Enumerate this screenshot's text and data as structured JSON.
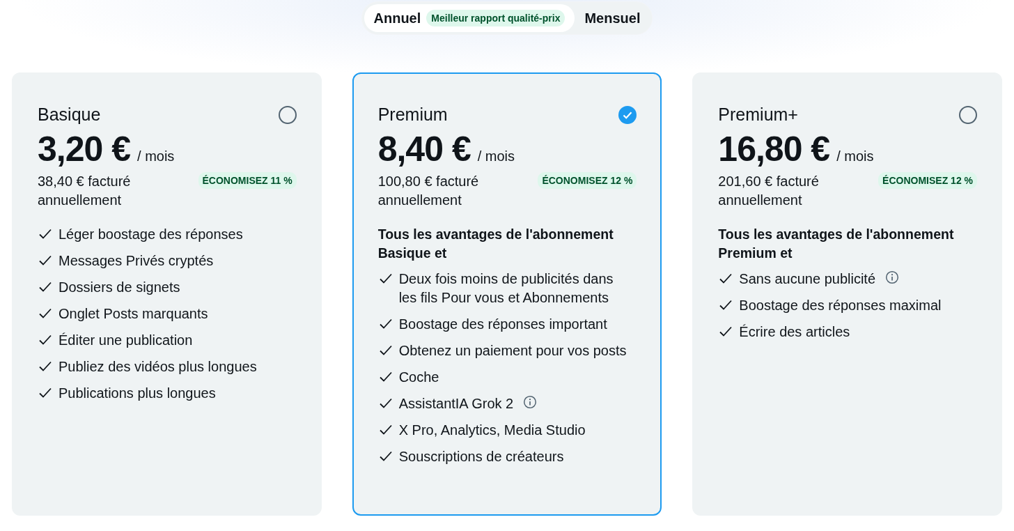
{
  "billing_toggle": [
    {
      "label": "Annuel",
      "selected": true,
      "badge": "Meilleur rapport qualité-prix"
    },
    {
      "label": "Mensuel",
      "selected": false
    }
  ],
  "plans": [
    {
      "name": "Basique",
      "selected": false,
      "price": "3,20 €",
      "period": "/ mois",
      "billed": "38,40 € facturé annuellement",
      "savings": "ÉCONOMISEZ 11 %",
      "features": [
        {
          "text": "Léger boostage des réponses",
          "info": false
        },
        {
          "text": "Messages Privés cryptés",
          "info": false
        },
        {
          "text": "Dossiers de signets",
          "info": false
        },
        {
          "text": "Onglet Posts marquants",
          "info": false
        },
        {
          "text": "Éditer une publication",
          "info": false
        },
        {
          "text": "Publiez des vidéos plus longues",
          "info": false
        },
        {
          "text": "Publications plus longues",
          "info": false
        }
      ]
    },
    {
      "name": "Premium",
      "selected": true,
      "price": "8,40 €",
      "period": "/ mois",
      "billed": "100,80 € facturé annuellement",
      "savings": "ÉCONOMISEZ 12 %",
      "intro": "Tous les avantages de l'abonnement Basique et",
      "features": [
        {
          "text": "Deux fois moins de publicités dans les fils Pour vous et Abonnements",
          "info": false
        },
        {
          "text": "Boostage des réponses important",
          "info": false
        },
        {
          "text": "Obtenez un paiement pour vos posts",
          "info": false
        },
        {
          "text": "Coche",
          "info": false
        },
        {
          "text": "AssistantIA Grok 2",
          "info": true
        },
        {
          "text": "X Pro, Analytics, Media Studio",
          "info": false
        },
        {
          "text": "Souscriptions de créateurs",
          "info": false
        }
      ]
    },
    {
      "name": "Premium+",
      "selected": false,
      "price": "16,80 €",
      "period": "/ mois",
      "billed": "201,60 € facturé annuellement",
      "savings": "ÉCONOMISEZ 12 %",
      "intro": "Tous les avantages de l'abonnement Premium et",
      "features": [
        {
          "text": "Sans aucune publicité",
          "info": true
        },
        {
          "text": "Boostage des réponses maximal",
          "info": false
        },
        {
          "text": "Écrire des articles",
          "info": false
        }
      ]
    }
  ]
}
